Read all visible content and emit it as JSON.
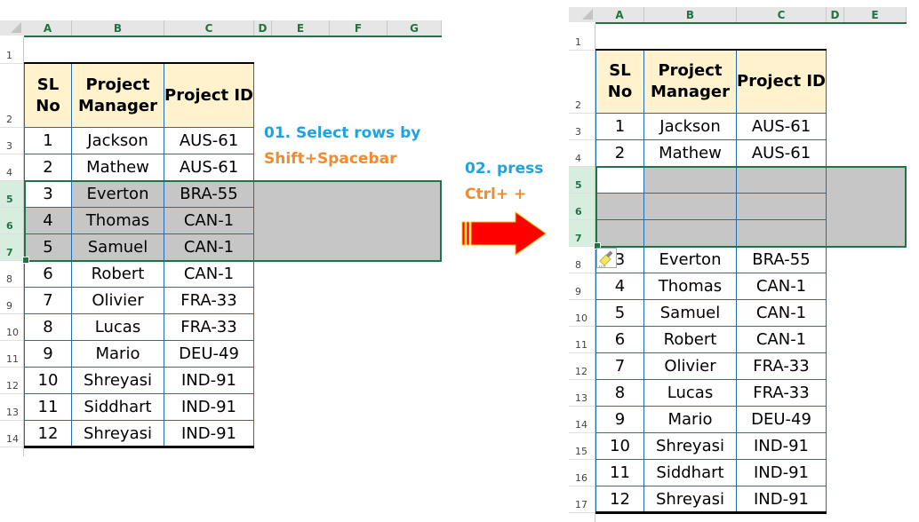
{
  "columns_left": [
    "A",
    "B",
    "C",
    "D",
    "E",
    "F",
    "G"
  ],
  "columns_right": [
    "A",
    "B",
    "C",
    "D",
    "E"
  ],
  "table_headers": {
    "sl": "SL\nNo",
    "sl_line1": "SL",
    "sl_line2": "No",
    "pm_line1": "Project",
    "pm_line2": "Manager",
    "pid": "Project ID"
  },
  "left_sheet": {
    "row_numbers": [
      "1",
      "2",
      "3",
      "4",
      "5",
      "6",
      "7",
      "8",
      "9",
      "10",
      "11",
      "12",
      "13",
      "14"
    ],
    "selected_rows": [
      "5",
      "6",
      "7"
    ],
    "rows": [
      {
        "sl": "1",
        "pm": "Jackson",
        "pid": "AUS-61"
      },
      {
        "sl": "2",
        "pm": "Mathew",
        "pid": "AUS-61"
      },
      {
        "sl": "3",
        "pm": "Everton",
        "pid": "BRA-55"
      },
      {
        "sl": "4",
        "pm": "Thomas",
        "pid": "CAN-1"
      },
      {
        "sl": "5",
        "pm": "Samuel",
        "pid": "CAN-1"
      },
      {
        "sl": "6",
        "pm": "Robert",
        "pid": "CAN-1"
      },
      {
        "sl": "7",
        "pm": "Olivier",
        "pid": "FRA-33"
      },
      {
        "sl": "8",
        "pm": "Lucas",
        "pid": "FRA-33"
      },
      {
        "sl": "9",
        "pm": "Mario",
        "pid": "DEU-49"
      },
      {
        "sl": "10",
        "pm": "Shreyasi",
        "pid": "IND-91"
      },
      {
        "sl": "11",
        "pm": "Siddhart",
        "pid": "IND-91"
      },
      {
        "sl": "12",
        "pm": "Shreyasi",
        "pid": "IND-91"
      }
    ]
  },
  "right_sheet": {
    "row_numbers": [
      "1",
      "2",
      "3",
      "4",
      "5",
      "6",
      "7",
      "8",
      "9",
      "10",
      "11",
      "12",
      "13",
      "14",
      "15",
      "16",
      "17"
    ],
    "selected_rows": [
      "5",
      "6",
      "7"
    ],
    "rows": [
      {
        "sl": "1",
        "pm": "Jackson",
        "pid": "AUS-61"
      },
      {
        "sl": "2",
        "pm": "Mathew",
        "pid": "AUS-61"
      },
      {
        "sl": "",
        "pm": "",
        "pid": ""
      },
      {
        "sl": "",
        "pm": "",
        "pid": ""
      },
      {
        "sl": "",
        "pm": "",
        "pid": ""
      },
      {
        "sl": "3",
        "pm": "Everton",
        "pid": "BRA-55"
      },
      {
        "sl": "4",
        "pm": "Thomas",
        "pid": "CAN-1"
      },
      {
        "sl": "5",
        "pm": "Samuel",
        "pid": "CAN-1"
      },
      {
        "sl": "6",
        "pm": "Robert",
        "pid": "CAN-1"
      },
      {
        "sl": "7",
        "pm": "Olivier",
        "pid": "FRA-33"
      },
      {
        "sl": "8",
        "pm": "Lucas",
        "pid": "FRA-33"
      },
      {
        "sl": "9",
        "pm": "Mario",
        "pid": "DEU-49"
      },
      {
        "sl": "10",
        "pm": "Shreyasi",
        "pid": "IND-91"
      },
      {
        "sl": "11",
        "pm": "Siddhart",
        "pid": "IND-91"
      },
      {
        "sl": "12",
        "pm": "Shreyasi",
        "pid": "IND-91"
      }
    ]
  },
  "annotations": {
    "step1_line1": "01. Select rows by",
    "step1_line2": "Shift+Spacebar",
    "step2_line1": "02. press",
    "step2_line2": "Ctrl+ +"
  },
  "icons": {
    "arrow": "right-arrow-icon",
    "paste_options": "paste-options-brush-icon"
  },
  "colors": {
    "accent_green": "#217346",
    "header_fill": "#fff2cc",
    "border_blue": "#1f6eb5",
    "selection_grey": "#c6c6c6",
    "note_blue": "#1fa3e0",
    "note_orange": "#f28a30",
    "arrow_red": "#ff0000"
  }
}
